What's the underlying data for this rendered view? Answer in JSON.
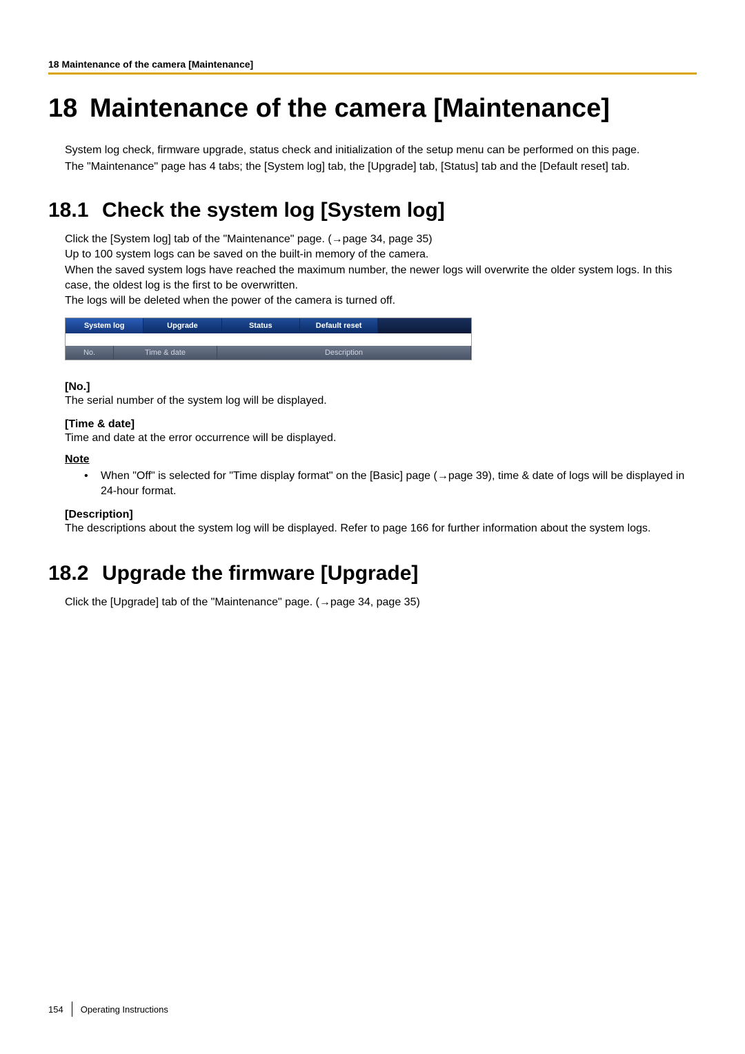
{
  "header": {
    "label": "18 Maintenance of the camera [Maintenance]"
  },
  "h1": {
    "num": "18",
    "title": "Maintenance of the camera [Maintenance]"
  },
  "intro": {
    "p1": "System log check, firmware upgrade, status check and initialization of the setup menu can be performed on this page.",
    "p2": "The \"Maintenance\" page has 4 tabs; the [System log] tab, the [Upgrade] tab, [Status] tab and the [Default reset] tab."
  },
  "s1": {
    "num": "18.1",
    "title": "Check the system log [System log]",
    "p1a": "Click the [System log] tab of the \"Maintenance\" page. (",
    "p1b": "page 34, page 35)",
    "p2": "Up to 100 system logs can be saved on the built-in memory of the camera.",
    "p3": "When the saved system logs have reached the maximum number, the newer logs will overwrite the older system logs. In this case, the oldest log is the first to be overwritten.",
    "p4": "The logs will be deleted when the power of the camera is turned off."
  },
  "tabs": {
    "t1": "System log",
    "t2": "Upgrade",
    "t3": "Status",
    "t4": "Default reset",
    "h1": "No.",
    "h2": "Time & date",
    "h3": "Description"
  },
  "fields": {
    "no_title": "[No.]",
    "no_desc": "The serial number of the system log will be displayed.",
    "td_title": "[Time & date]",
    "td_desc": "Time and date at the error occurrence will be displayed.",
    "note_label": "Note",
    "note_text_a": "When \"Off\" is selected for \"Time display format\" on the [Basic] page (",
    "note_text_b": "page 39), time & date of logs will be displayed in 24-hour format.",
    "desc_title": "[Description]",
    "desc_desc": "The descriptions about the system log will be displayed. Refer to page 166 for further information about the system logs."
  },
  "s2": {
    "num": "18.2",
    "title": "Upgrade the firmware [Upgrade]",
    "p1a": "Click the [Upgrade] tab of the \"Maintenance\" page. (",
    "p1b": "page 34, page 35)"
  },
  "footer": {
    "page": "154",
    "doc": "Operating Instructions"
  },
  "glyph": {
    "arrow": "→",
    "bullet": "•"
  }
}
